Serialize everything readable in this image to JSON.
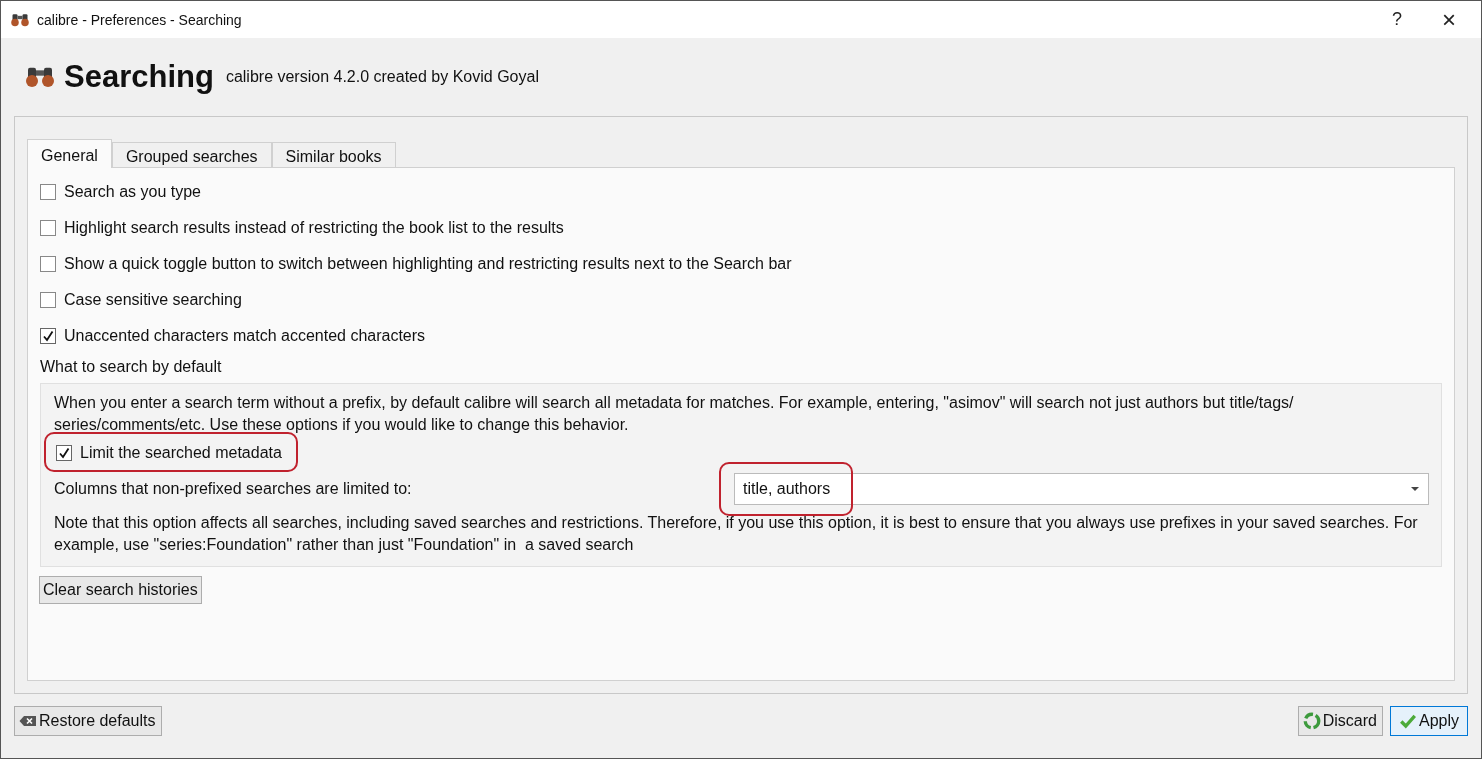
{
  "window": {
    "title": "calibre - Preferences - Searching",
    "help": "?",
    "close": "×"
  },
  "header": {
    "title": "Searching",
    "subtitle": "calibre version 4.2.0 created by Kovid Goyal"
  },
  "tabs": [
    {
      "label": "General",
      "selected": true
    },
    {
      "label": "Grouped searches",
      "selected": false
    },
    {
      "label": "Similar books",
      "selected": false
    }
  ],
  "options": [
    {
      "label": "Search as you type",
      "checked": false
    },
    {
      "label": "Highlight search results instead of restricting the book list to the results",
      "checked": false
    },
    {
      "label": "Show a quick toggle button to switch between highlighting and restricting results next to the Search bar",
      "checked": false
    },
    {
      "label": "Case sensitive searching",
      "checked": false
    },
    {
      "label": "Unaccented characters match accented characters",
      "checked": true
    }
  ],
  "default_search": {
    "heading": "What to search by default",
    "description": "When you enter a search term without a prefix, by default calibre will search all metadata for matches. For example, entering, \"asimov\" will search not just authors but title/tags/ series/comments/etc. Use these options if you would like to change this behavior.",
    "limit": {
      "label": "Limit the searched metadata",
      "checked": true,
      "highlighted": true
    },
    "columns": {
      "label": "Columns that non-prefixed searches are limited to:",
      "value": "title, authors",
      "highlighted": true
    },
    "note": "Note that this option affects all searches, including saved searches and restrictions. Therefore, if you use this option, it is best to ensure that you always use prefixes in your saved searches. For example, use \"series:Foundation\" rather than just \"Foundation\" in  a saved search"
  },
  "clear_button": "Clear search histories",
  "footer": {
    "restore": "Restore defaults",
    "discard": "Discard",
    "apply": "Apply"
  }
}
